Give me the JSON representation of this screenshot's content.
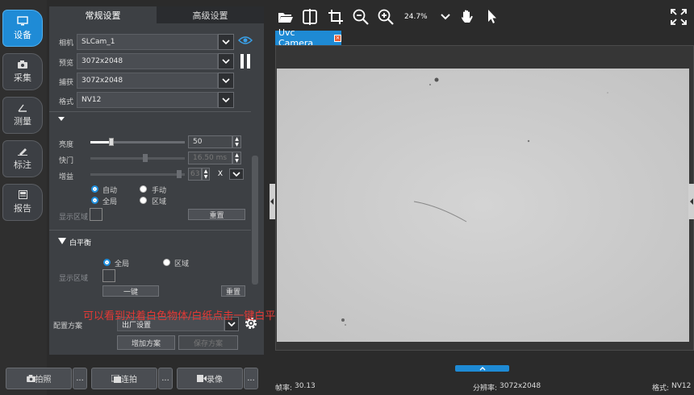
{
  "sidebar": {
    "items": [
      {
        "label": "设备",
        "icon": "monitor-icon",
        "active": true
      },
      {
        "label": "采集",
        "icon": "camera-icon",
        "active": false
      },
      {
        "label": "测量",
        "icon": "angle-icon",
        "active": false
      },
      {
        "label": "标注",
        "icon": "pen-icon",
        "active": false
      },
      {
        "label": "报告",
        "icon": "report-icon",
        "active": false
      }
    ]
  },
  "panel": {
    "tabs": {
      "basic": "常规设置",
      "advanced": "高级设置"
    },
    "camera_label": "相机",
    "camera_value": "SLCam_1",
    "preview_label": "预览",
    "preview_value": "3072x2048",
    "capture_label": "捕获",
    "capture_value": "3072x2048",
    "format_label": "格式",
    "format_value": "NV12",
    "exposure": {
      "brightness_label": "亮度",
      "brightness_value": "50",
      "brightness_level": 0.22,
      "shutter_label": "快门",
      "shutter_value": "16.50 ms",
      "shutter_level": 0.58,
      "gain_label": "增益",
      "gain_value": "63",
      "gain_level": 0.97,
      "auto_label": "自动",
      "manual_label": "手动",
      "global_label": "全局",
      "region_label": "区域",
      "display_region_label": "显示区域",
      "reset_label": "重置"
    },
    "white_balance": {
      "title": "白平衡",
      "global_label": "全局",
      "region_label": "区域",
      "display_region_label": "显示区域",
      "one_key_label": "一键",
      "reset_label": "重置"
    },
    "preset_label": "配置方案",
    "preset_value": "出厂设置",
    "add_preset": "增加方案",
    "save_preset": "保存方案"
  },
  "overlay_caption": "可以看到对着白色物体/白纸点击一键白平衡之后颜色恢复正常",
  "bottom": {
    "photo": "拍照",
    "burst": "连拍",
    "record": "录像",
    "more": "..."
  },
  "toolbar": {
    "zoom": "24.7%"
  },
  "camera_tab": "Uvc Camera",
  "status": {
    "fps_label": "帧率:",
    "fps_value": "30.13",
    "resolution_label": "分辨率:",
    "resolution_value": "3072x2048",
    "format_label": "格式:",
    "format_value": "NV12"
  },
  "colors": {
    "accent": "#1e8ad4",
    "caption": "#e53935"
  }
}
